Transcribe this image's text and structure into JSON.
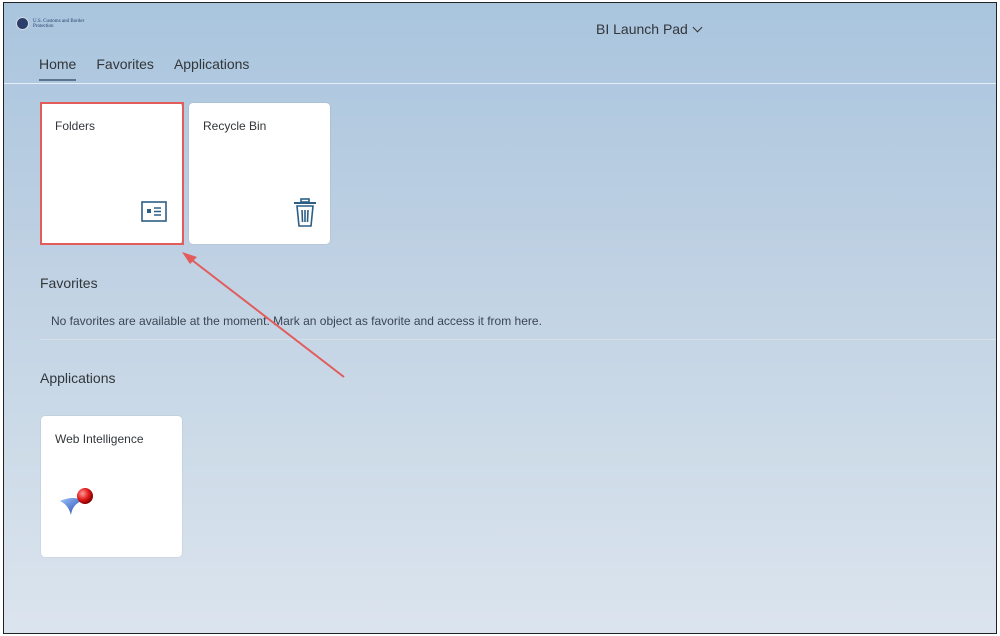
{
  "header": {
    "logo_text": "U.S. Customs and Border Protection",
    "app_title": "BI Launch Pad"
  },
  "nav": {
    "tabs": [
      {
        "label": "Home",
        "active": true
      },
      {
        "label": "Favorites",
        "active": false
      },
      {
        "label": "Applications",
        "active": false
      }
    ]
  },
  "home": {
    "tiles": [
      {
        "title": "Folders",
        "icon": "folder-card-icon"
      },
      {
        "title": "Recycle Bin",
        "icon": "trash-icon"
      }
    ]
  },
  "favorites": {
    "heading": "Favorites",
    "empty_message": "No favorites are available at the moment. Mark an object as favorite and access it from here."
  },
  "applications": {
    "heading": "Applications",
    "tiles": [
      {
        "title": "Web Intelligence",
        "icon": "web-intelligence-icon"
      }
    ]
  },
  "colors": {
    "accent": "#5b738b",
    "highlight": "#e25c5c",
    "text": "#32363a"
  }
}
